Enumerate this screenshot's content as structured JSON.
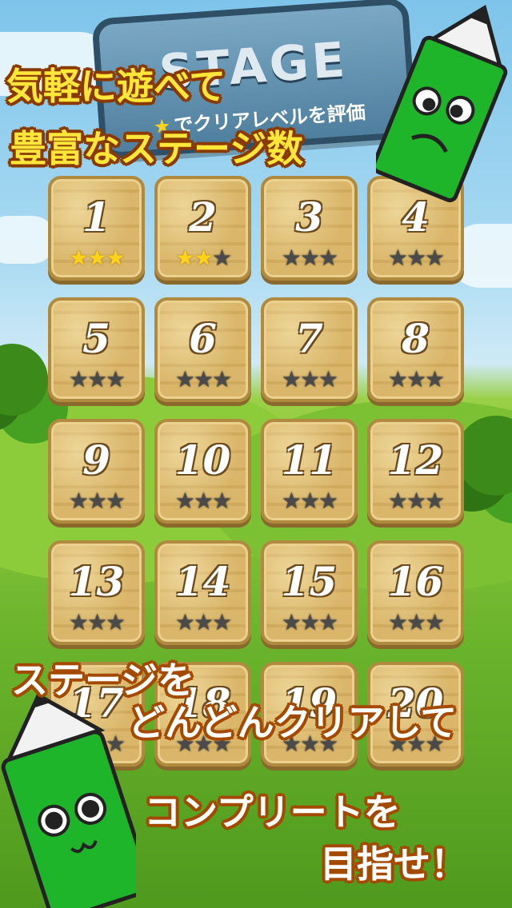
{
  "header": {
    "sign_title": "STAGE",
    "sign_subtitle": "でクリアレベルを評価"
  },
  "promo": {
    "line1": "気軽に遊べて",
    "line2": "豊富なステージ数",
    "line3": "ステージを",
    "line4": "どんどんクリアして",
    "line5": "コンプリートを",
    "line6": "目指せ！"
  },
  "stages": [
    {
      "label": "1",
      "stars": 3
    },
    {
      "label": "2",
      "stars": 2
    },
    {
      "label": "3",
      "stars": 0
    },
    {
      "label": "4",
      "stars": 0
    },
    {
      "label": "5",
      "stars": 0
    },
    {
      "label": "6",
      "stars": 0
    },
    {
      "label": "7",
      "stars": 0
    },
    {
      "label": "8",
      "stars": 0
    },
    {
      "label": "9",
      "stars": 0
    },
    {
      "label": "10",
      "stars": 0
    },
    {
      "label": "11",
      "stars": 0
    },
    {
      "label": "12",
      "stars": 0
    },
    {
      "label": "13",
      "stars": 0
    },
    {
      "label": "14",
      "stars": 0
    },
    {
      "label": "15",
      "stars": 0
    },
    {
      "label": "16",
      "stars": 0
    },
    {
      "label": "17",
      "stars": 0
    },
    {
      "label": "18",
      "stars": 0
    },
    {
      "label": "19",
      "stars": 0
    },
    {
      "label": "20",
      "stars": 0
    }
  ],
  "colors": {
    "star_earned": "#ffd21a",
    "star_empty": "#4a4a4a",
    "mascot_green": "#1fb52a"
  }
}
